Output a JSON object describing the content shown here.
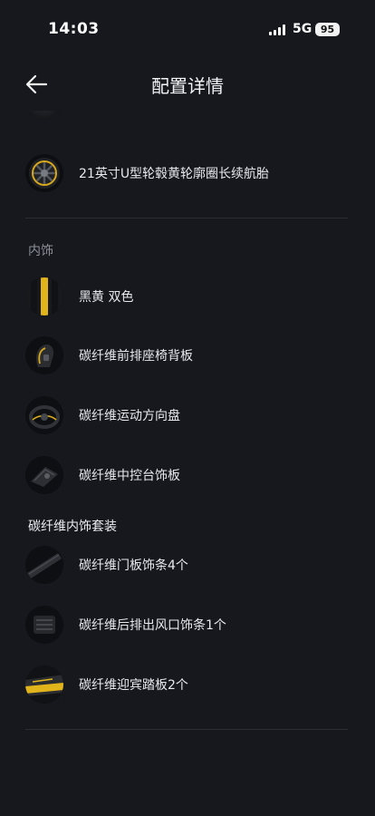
{
  "status_bar": {
    "time": "14:03",
    "network": "5G",
    "battery": "95"
  },
  "nav": {
    "title": "配置详情"
  },
  "wheels_item": {
    "label": "21英寸U型轮毂黄轮廓圈长续航胎"
  },
  "interior": {
    "heading": "内饰",
    "items": [
      {
        "label": "黑黄 双色"
      },
      {
        "label": "碳纤维前排座椅背板"
      },
      {
        "label": "碳纤维运动方向盘"
      },
      {
        "label": "碳纤维中控台饰板"
      }
    ]
  },
  "carbon_package": {
    "heading": "碳纤维内饰套装",
    "items": [
      {
        "label": "碳纤维门板饰条4个"
      },
      {
        "label": "碳纤维后排出风口饰条1个"
      },
      {
        "label": "碳纤维迎宾踏板2个"
      }
    ]
  },
  "colors": {
    "background": "#16181e",
    "accent_yellow": "#e8b820",
    "divider": "#2a2d34"
  }
}
